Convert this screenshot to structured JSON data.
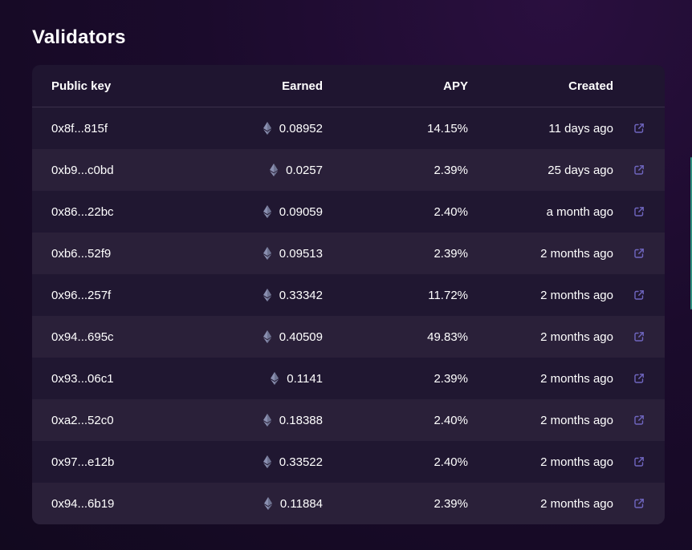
{
  "page": {
    "title": "Validators"
  },
  "table": {
    "columns": {
      "public_key": "Public key",
      "earned": "Earned",
      "apy": "APY",
      "created": "Created"
    },
    "rows": [
      {
        "public_key": "0x8f...815f",
        "earned": "0.08952",
        "apy": "14.15%",
        "created": "11 days ago"
      },
      {
        "public_key": "0xb9...c0bd",
        "earned": "0.0257",
        "apy": "2.39%",
        "created": "25 days ago"
      },
      {
        "public_key": "0x86...22bc",
        "earned": "0.09059",
        "apy": "2.40%",
        "created": "a month ago"
      },
      {
        "public_key": "0xb6...52f9",
        "earned": "0.09513",
        "apy": "2.39%",
        "created": "2 months ago"
      },
      {
        "public_key": "0x96...257f",
        "earned": "0.33342",
        "apy": "11.72%",
        "created": "2 months ago"
      },
      {
        "public_key": "0x94...695c",
        "earned": "0.40509",
        "apy": "49.83%",
        "created": "2 months ago"
      },
      {
        "public_key": "0x93...06c1",
        "earned": "0.1141",
        "apy": "2.39%",
        "created": "2 months ago"
      },
      {
        "public_key": "0xa2...52c0",
        "earned": "0.18388",
        "apy": "2.40%",
        "created": "2 months ago"
      },
      {
        "public_key": "0x97...e12b",
        "earned": "0.33522",
        "apy": "2.40%",
        "created": "2 months ago"
      },
      {
        "public_key": "0x94...6b19",
        "earned": "0.11884",
        "apy": "2.39%",
        "created": "2 months ago"
      }
    ]
  },
  "icons": {
    "currency": "ethereum-icon",
    "row_action": "external-link-icon"
  },
  "colors": {
    "background": "#1b0b2c",
    "card": "#1f1530",
    "row_alt": "#2a2039",
    "icon": "#7b72c9",
    "accent": "#2f8f7f"
  }
}
